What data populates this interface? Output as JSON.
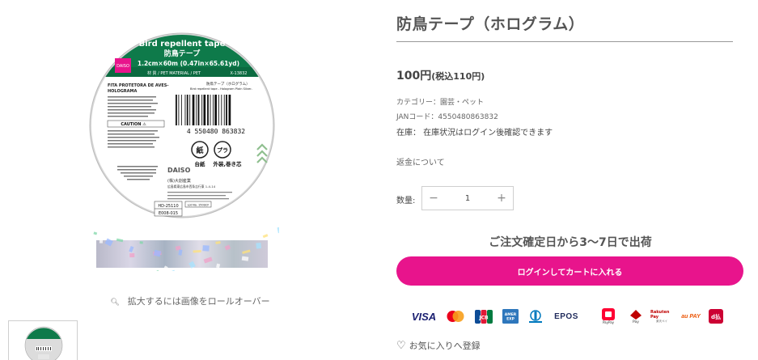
{
  "product": {
    "title": "防鳥テープ（ホログラム）",
    "price": "100円",
    "price_tax": "(税込110円)",
    "category": "カテゴリー：園芸・ペット",
    "jan": "JANコード：4550480863832",
    "stock": "在庫：  在庫状況はログイン後確認できます",
    "refund_link": "返金について"
  },
  "gallery": {
    "zoom_hint": "拡大するには画像をロールオーバー",
    "package": {
      "band_title": "Bird repellent tape",
      "band_title_jp": "防鳥テープ",
      "size": "1.2cm×60m (0.47in×65.61yd)",
      "material": "材 質 / PET  MATERIAL / PET",
      "code": "X-13832",
      "brand": "DAISO",
      "barcode": "4 550480 863832",
      "left_text_1": "FITA PROTETORA DE AVES-",
      "left_text_2": "HOLOGRAMA",
      "right_text_1": "防鳥テープ（ホログラム）",
      "right_text_2": "Bird repellent tape - Hologram Plain Silver-",
      "caution": "CAUTION ⚠",
      "recycle_1": "紙",
      "recycle_2": "プラ",
      "recycle_label_1": "台紙",
      "recycle_label_2": "外装,巻き芯",
      "maker": "(株)大創産業",
      "address": "広島県東広島市西条吉行東 1-4-14",
      "lot_1": "HD-25110",
      "lot_2": "E008-015",
      "lot_3": "Lot No. 150SCF"
    }
  },
  "quantity": {
    "label": "数量:",
    "value": "1",
    "minus": "−",
    "plus": "+"
  },
  "delivery": "ご注文確定日から3〜7日で出荷",
  "cart_button": "ログインしてカートに入れる",
  "payments": [
    "VISA",
    "Mastercard",
    "JCB",
    "American Express",
    "Diners Club",
    "EPOS",
    "PayPay",
    "楽天Pay",
    "Rakuten Pay",
    "au PAY",
    "d払い"
  ],
  "favorite": "お気に入りへ登録",
  "colors": {
    "accent": "#e8148c",
    "band_green": "#0e7a4a"
  }
}
